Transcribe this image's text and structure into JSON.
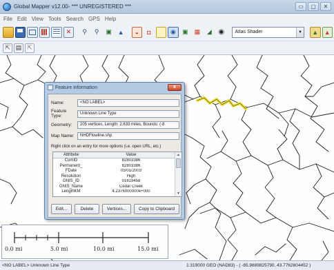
{
  "window": {
    "title": "Global Mapper v12.00- *** UNREGISTERED ***",
    "controls": [
      "▭",
      "▢",
      "✕"
    ]
  },
  "menu": [
    "File",
    "Edit",
    "View",
    "Tools",
    "Search",
    "GPS",
    "Help"
  ],
  "toolbar": {
    "shader_select": "Atlas Shader"
  },
  "scale_bar": {
    "labels": [
      "0.0 mi",
      "5.0 mi",
      "10.0 mi",
      "15.0 mi"
    ]
  },
  "status": {
    "left": "<NO LABEL> Unknown Line Type",
    "right": "1:319000  GEO (NAD83) - ( -85.9689825790, 43.7762604452 )"
  },
  "dialog": {
    "title": "Feature Information",
    "close_label": "x",
    "fields": [
      {
        "label": "Name:",
        "value": "<NO LABEL>"
      },
      {
        "label": "Feature Type:",
        "value": "Unknown Line Type"
      },
      {
        "label": "Geometry:",
        "value": "205 vertices, Length: 2.633 miles, Bounds: (-8"
      },
      {
        "label": "Map Name:",
        "value": "NHDFlowline.shp"
      }
    ],
    "hint": "Right click on an entry for more options (i.e. open URL, etc.)",
    "table": {
      "headers": [
        "Attribute",
        "Value"
      ],
      "rows": [
        [
          "ComID",
          "82803386"
        ],
        [
          "Permanent_",
          "82803386"
        ],
        [
          "FDate",
          "05/01/2003"
        ],
        [
          "Resolution",
          "High"
        ],
        [
          "GNIS_ID",
          "01619458"
        ],
        [
          "GNIS_Name",
          "Cedar Creek"
        ],
        [
          "LengthKM",
          "4.2376000000e+000"
        ]
      ]
    },
    "buttons": [
      "Edit...",
      "Delete",
      "Vertices...",
      "Copy to Clipboard"
    ]
  },
  "colors": {
    "river": "#1c1c1c",
    "highlight": "#f1e03a",
    "dialog_frame": "#b5cbe4"
  }
}
